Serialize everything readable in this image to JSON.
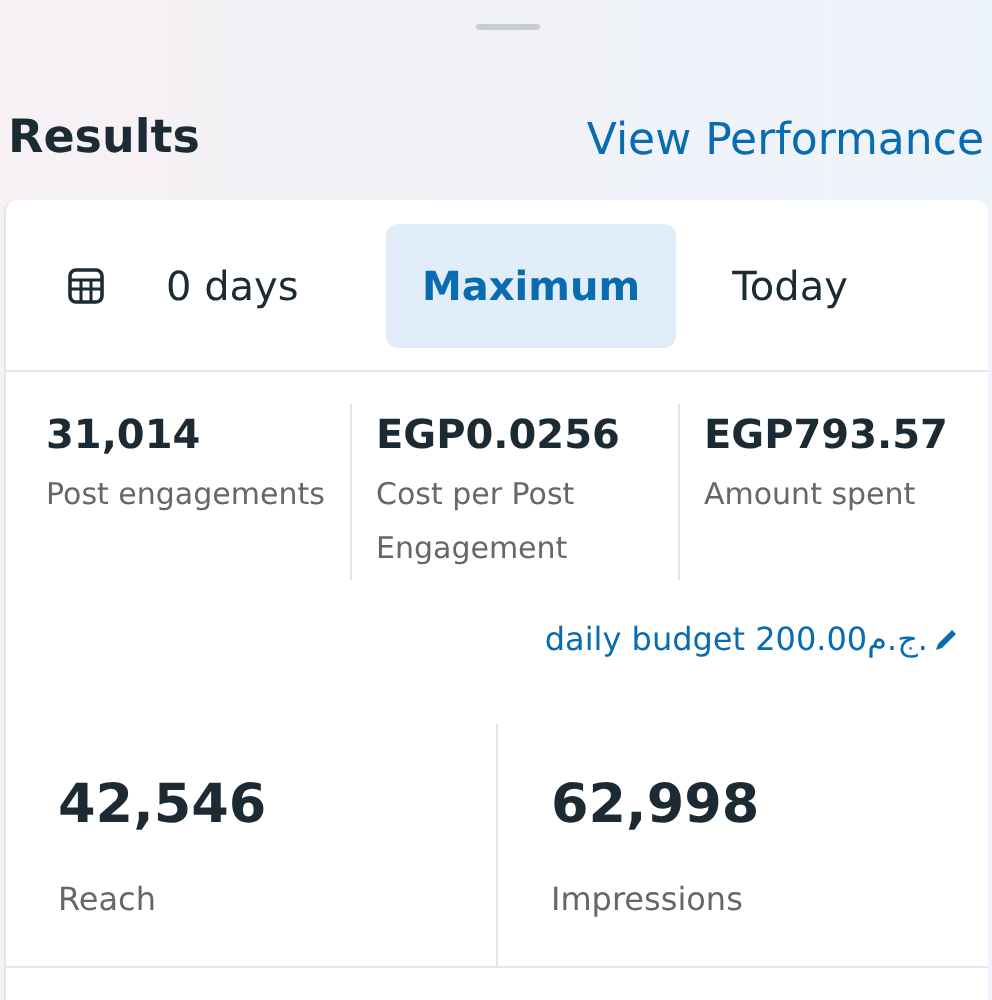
{
  "header": {
    "title": "Results",
    "link": "View Performance"
  },
  "date_tabs": [
    {
      "label": "0 days",
      "selected": false,
      "kind": "calendar"
    },
    {
      "label": "Maximum",
      "selected": true,
      "kind": "plain"
    },
    {
      "label": "Today",
      "selected": false,
      "kind": "plain"
    }
  ],
  "metrics": [
    {
      "value": "31,014",
      "label": "Post engagements"
    },
    {
      "value": "EGP0.0256",
      "label": "Cost per Post Engagement"
    },
    {
      "value": "EGP793.57",
      "label": "Amount spent"
    }
  ],
  "budget_link": "daily budget 200.00ج.م.",
  "totals": [
    {
      "value": "42,546",
      "label": "Reach"
    },
    {
      "value": "62,998",
      "label": "Impressions"
    }
  ]
}
